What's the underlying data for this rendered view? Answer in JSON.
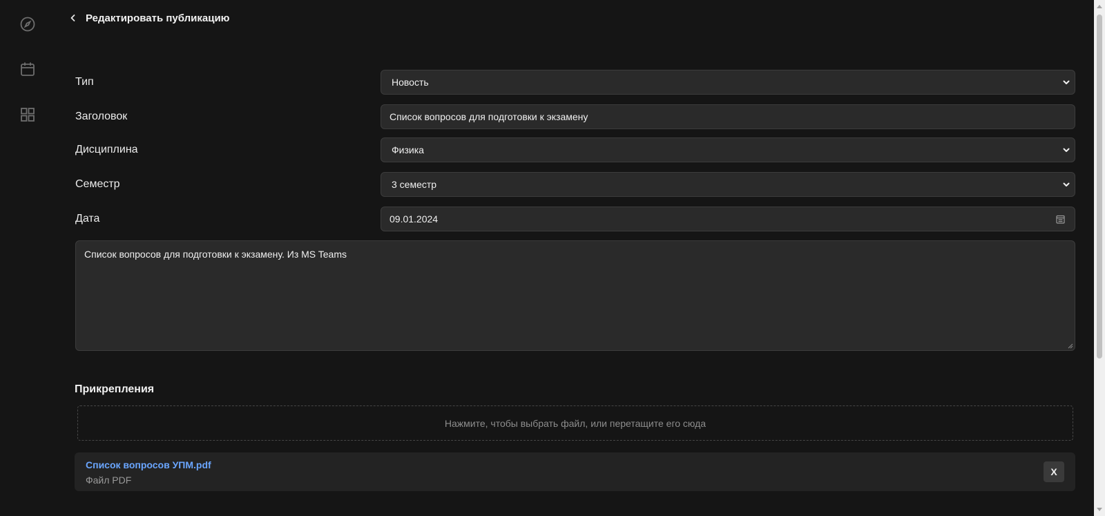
{
  "sidebar": {
    "items": [
      {
        "icon": "compass-icon"
      },
      {
        "icon": "calendar-icon"
      },
      {
        "icon": "grid-icon"
      }
    ]
  },
  "header": {
    "back_icon": "chevron-left-icon",
    "title": "Редактировать публикацию"
  },
  "form": {
    "type": {
      "label": "Тип",
      "value": "Новость"
    },
    "title": {
      "label": "Заголовок",
      "value": "Список вопросов для подготовки к экзамену"
    },
    "discipline": {
      "label": "Дисциплина",
      "value": "Физика"
    },
    "semester": {
      "label": "Семестр",
      "value": "3 семестр"
    },
    "date": {
      "label": "Дата",
      "value": "09.01.2024"
    },
    "body": "Список вопросов для подготовки к экзамену. Из MS Teams"
  },
  "attachments": {
    "title": "Прикрепления",
    "dropzone_text": "Нажмите, чтобы выбрать файл, или перетащите его сюда",
    "files": [
      {
        "name": "Список вопросов УПМ.pdf",
        "type": "Файл PDF",
        "remove_label": "X"
      }
    ]
  },
  "colors": {
    "background": "#151515",
    "field": "#2a2a2a",
    "link": "#6aa6ff"
  }
}
